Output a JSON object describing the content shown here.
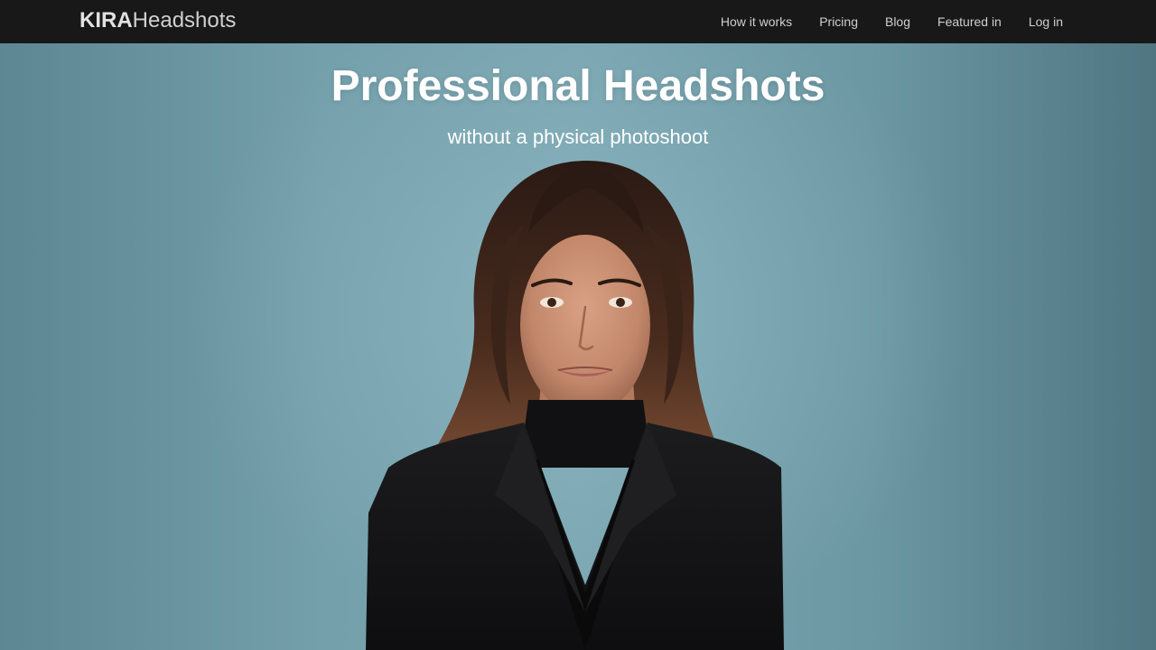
{
  "header": {
    "logo_strong": "KIRA",
    "logo_light": "Headshots",
    "nav": [
      {
        "label": "How it works"
      },
      {
        "label": "Pricing"
      },
      {
        "label": "Blog"
      },
      {
        "label": "Featured in"
      },
      {
        "label": "Log in"
      }
    ]
  },
  "hero": {
    "title": "Professional Headshots",
    "subtitle": "without a physical photoshoot",
    "photo_subject": "woman-headshot-photo"
  },
  "colors": {
    "navbar": "#181818",
    "background": "#6b97a3",
    "hero_text": "#ffffff"
  }
}
